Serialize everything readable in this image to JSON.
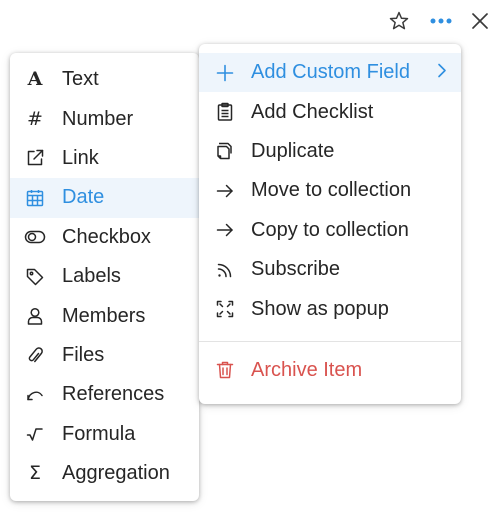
{
  "toolbar": {
    "icons": [
      "star-icon",
      "more-horizontal-icon",
      "close-icon"
    ],
    "accent_color": "#2f8fe0"
  },
  "field_type_menu": {
    "items": [
      {
        "label": "Text",
        "icon": "text-type-icon"
      },
      {
        "label": "Number",
        "icon": "hash-icon"
      },
      {
        "label": "Link",
        "icon": "external-link-icon"
      },
      {
        "label": "Date",
        "icon": "calendar-icon",
        "active": true
      },
      {
        "label": "Checkbox",
        "icon": "toggle-icon"
      },
      {
        "label": "Labels",
        "icon": "tag-icon"
      },
      {
        "label": "Members",
        "icon": "user-icon"
      },
      {
        "label": "Files",
        "icon": "paperclip-icon"
      },
      {
        "label": "References",
        "icon": "reference-icon"
      },
      {
        "label": "Formula",
        "icon": "square-root-icon"
      },
      {
        "label": "Aggregation",
        "icon": "sigma-icon"
      }
    ]
  },
  "action_menu": {
    "items": [
      {
        "label": "Add Custom Field",
        "icon": "plus-icon",
        "active": true,
        "submenu": true
      },
      {
        "label": "Add Checklist",
        "icon": "checklist-icon"
      },
      {
        "label": "Duplicate",
        "icon": "duplicate-icon"
      },
      {
        "label": "Move to collection",
        "icon": "arrow-right-icon"
      },
      {
        "label": "Copy to collection",
        "icon": "arrow-right-icon"
      },
      {
        "label": "Subscribe",
        "icon": "rss-icon"
      },
      {
        "label": "Show as popup",
        "icon": "expand-icon"
      }
    ],
    "danger_item": {
      "label": "Archive Item",
      "icon": "trash-icon",
      "color": "#d9534f"
    }
  }
}
